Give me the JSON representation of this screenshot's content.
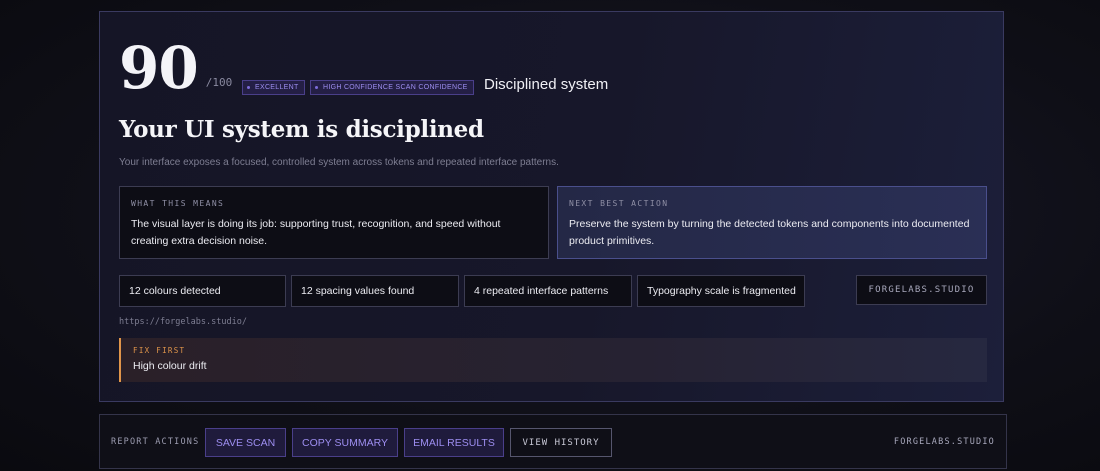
{
  "score": {
    "value": "90",
    "max": "/100",
    "badges": [
      "EXCELLENT",
      "HIGH CONFIDENCE SCAN CONFIDENCE"
    ],
    "status": "Disciplined system",
    "score_fraction": 0.9
  },
  "headline": "Your UI system is disciplined",
  "subtitle": "Your interface exposes a focused, controlled system across tokens and repeated interface patterns.",
  "what_this_means": {
    "label": "WHAT THIS MEANS",
    "body": "The visual layer is doing its job: supporting trust, recognition, and speed without creating extra decision noise."
  },
  "next_best_action": {
    "label": "NEXT BEST ACTION",
    "body": "Preserve the system by turning the detected tokens and components into documented product primitives."
  },
  "findings": [
    "12 colours detected",
    "12 spacing values found",
    "4 repeated interface patterns",
    "Typography scale is fragmented"
  ],
  "brand": "FORGELABS.STUDIO",
  "url": "https://forgelabs.studio/",
  "fix_first": {
    "label": "FIX FIRST",
    "body": "High colour drift"
  },
  "report_actions": {
    "label": "REPORT ACTIONS",
    "buttons": [
      "SAVE SCAN",
      "COPY SUMMARY",
      "EMAIL RESULTS",
      "VIEW HISTORY"
    ],
    "brand": "FORGELABS.STUDIO"
  },
  "colors": {
    "accent_purple": "#9d8ef0",
    "fix_orange": "#e0954a",
    "background": "#0f0f17"
  }
}
